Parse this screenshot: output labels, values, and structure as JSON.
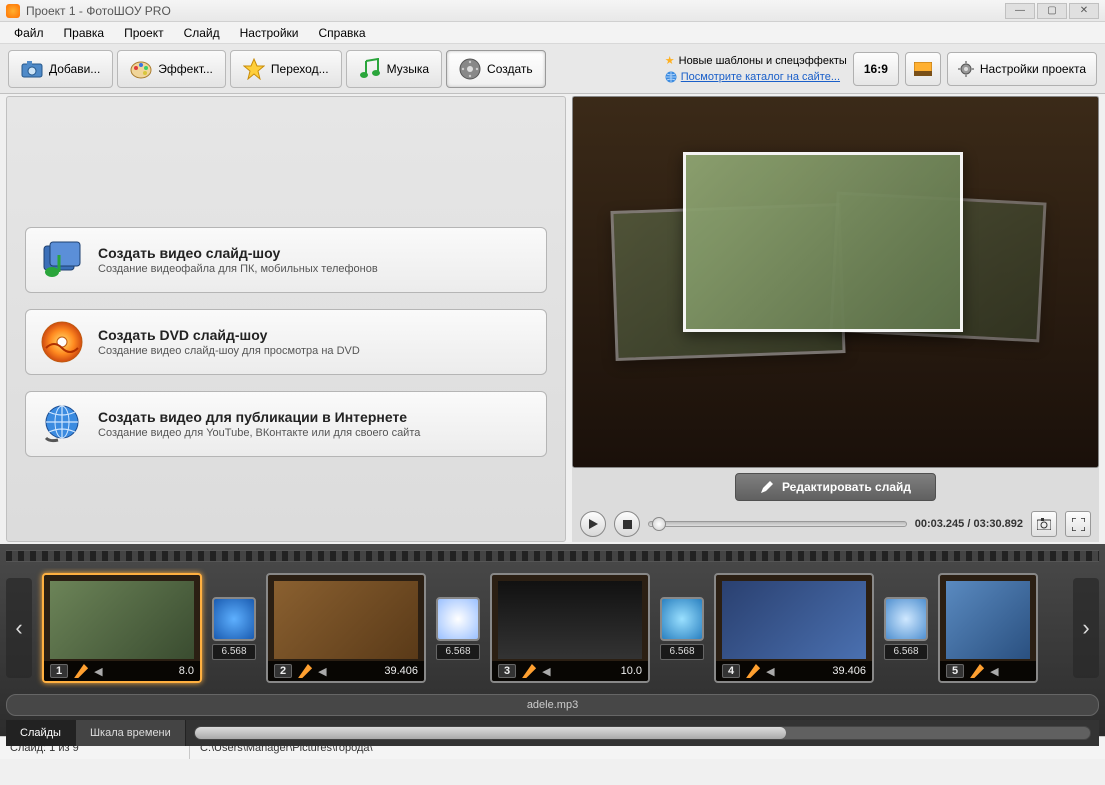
{
  "window": {
    "title": "Проект 1 - ФотоШОУ PRO"
  },
  "menu": [
    "Файл",
    "Правка",
    "Проект",
    "Слайд",
    "Настройки",
    "Справка"
  ],
  "tabs": [
    {
      "label": "Добави...",
      "icon": "camera-icon"
    },
    {
      "label": "Эффект...",
      "icon": "palette-icon"
    },
    {
      "label": "Переход...",
      "icon": "star-icon"
    },
    {
      "label": "Музыка",
      "icon": "music-icon"
    },
    {
      "label": "Создать",
      "icon": "export-icon",
      "active": true
    }
  ],
  "notices": {
    "line1": "Новые шаблоны и спецэффекты",
    "line2": "Посмотрите каталог на сайте..."
  },
  "aspect_button": "16:9",
  "settings_button": "Настройки проекта",
  "create_options": [
    {
      "title": "Создать видео слайд-шоу",
      "desc": "Создание видеофайла для ПК, мобильных телефонов",
      "icon": "video-icon"
    },
    {
      "title": "Создать DVD слайд-шоу",
      "desc": "Создание видео слайд-шоу для просмотра на DVD",
      "icon": "dvd-icon"
    },
    {
      "title": "Создать видео для публикации в Интернете",
      "desc": "Создание видео для YouTube, ВКонтакте или для своего сайта",
      "icon": "globe-icon"
    }
  ],
  "edit_slide_button": "Редактировать слайд",
  "playback": {
    "current": "00:03.245",
    "total": "03:30.892"
  },
  "slides": [
    {
      "num": "1",
      "duration": "8.0",
      "selected": true
    },
    {
      "num": "2",
      "duration": "39.406"
    },
    {
      "num": "3",
      "duration": "10.0"
    },
    {
      "num": "4",
      "duration": "39.406"
    },
    {
      "num": "5",
      "duration": ""
    }
  ],
  "transition_duration": "6.568",
  "audio_track": "adele.mp3",
  "view_tabs": {
    "slides": "Слайды",
    "timeline": "Шкала времени"
  },
  "status": {
    "slide_counter": "Слайд: 1 из 9",
    "path": "C:\\Users\\Manager\\Pictures\\города\\"
  }
}
